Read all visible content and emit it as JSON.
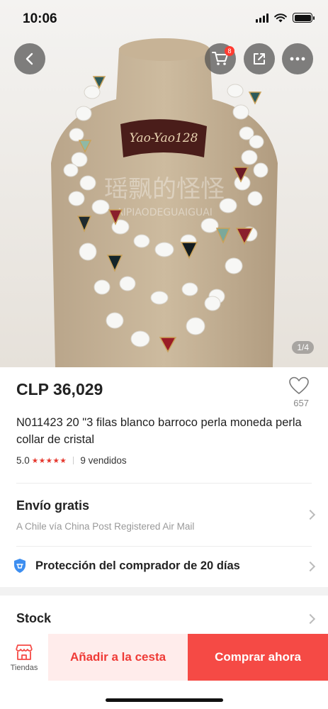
{
  "status_bar": {
    "time": "10:06"
  },
  "header": {
    "back_icon": "chevron-left-icon",
    "cart_icon": "cart-icon",
    "cart_badge": "8",
    "share_icon": "share-icon",
    "more_icon": "more-dots-icon"
  },
  "gallery": {
    "counter": "1/4",
    "watermark_brand": "Yao-Yao128",
    "watermark_cn": "瑶飘的怪怪",
    "watermark_latin": "AIPIAODEGUAIGUAI"
  },
  "product": {
    "price": "CLP 36,029",
    "wishlist_count": "657",
    "title": "N011423 20 \"3 filas blanco barroco perla moneda perla collar de cristal",
    "rating": "5.0",
    "stars": "★★★★★",
    "sold": "9 vendidos"
  },
  "shipping": {
    "title": "Envío gratis",
    "subtitle": "A Chile vía China Post Registered Air Mail"
  },
  "protection": {
    "label": "Protección del comprador de 20 días"
  },
  "stock": {
    "label": "Stock"
  },
  "bottom_bar": {
    "shop_label": "Tiendas",
    "add_to_cart": "Añadir a la cesta",
    "buy_now": "Comprar ahora"
  },
  "colors": {
    "accent_red": "#f54a45",
    "add_cart_bg": "#ffeceb",
    "add_cart_text": "#ef3a36",
    "star_red": "#e5352b",
    "shield_blue": "#3d8ef0"
  }
}
